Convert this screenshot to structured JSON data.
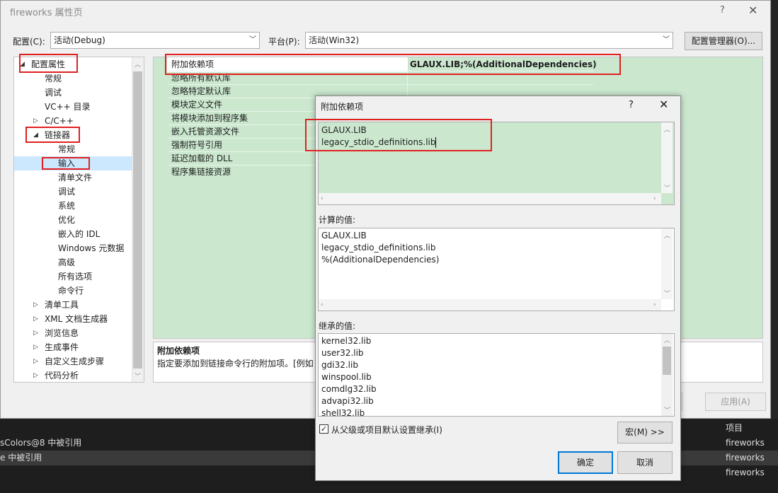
{
  "window": {
    "title": "fireworks 属性页",
    "help": "?",
    "close": "✕"
  },
  "toolbar": {
    "config_label": "配置(C):",
    "config_value": "活动(Debug)",
    "platform_label": "平台(P):",
    "platform_value": "活动(Win32)",
    "config_manager": "配置管理器(O)..."
  },
  "tree": {
    "items": [
      {
        "label": "配置属性",
        "expander": "◢"
      },
      {
        "label": "常规"
      },
      {
        "label": "调试"
      },
      {
        "label": "VC++ 目录"
      },
      {
        "label": "C/C++",
        "expander": "▷"
      },
      {
        "label": "链接器",
        "expander": "◢"
      },
      {
        "label": "常规"
      },
      {
        "label": "输入"
      },
      {
        "label": "清单文件"
      },
      {
        "label": "调试"
      },
      {
        "label": "系统"
      },
      {
        "label": "优化"
      },
      {
        "label": "嵌入的 IDL"
      },
      {
        "label": "Windows 元数据"
      },
      {
        "label": "高级"
      },
      {
        "label": "所有选项"
      },
      {
        "label": "命令行"
      },
      {
        "label": "清单工具",
        "expander": "▷"
      },
      {
        "label": "XML 文档生成器",
        "expander": "▷"
      },
      {
        "label": "浏览信息",
        "expander": "▷"
      },
      {
        "label": "生成事件",
        "expander": "▷"
      },
      {
        "label": "自定义生成步骤",
        "expander": "▷"
      },
      {
        "label": "代码分析",
        "expander": "▷"
      }
    ]
  },
  "grid": {
    "rows": [
      {
        "name": "附加依赖项",
        "value": "GLAUX.LIB;%(AdditionalDependencies)"
      },
      {
        "name": "忽略所有默认库"
      },
      {
        "name": "忽略特定默认库"
      },
      {
        "name": "模块定义文件"
      },
      {
        "name": "将模块添加到程序集"
      },
      {
        "name": "嵌入托管资源文件"
      },
      {
        "name": "强制符号引用"
      },
      {
        "name": "延迟加载的 DLL"
      },
      {
        "name": "程序集链接资源"
      }
    ],
    "description_title": "附加依赖项",
    "description_text": "指定要添加到链接命令行的附加项。[例如"
  },
  "bottom_buttons": {
    "apply": "应用(A)"
  },
  "dialog": {
    "title": "附加依赖项",
    "help": "?",
    "close": "✕",
    "edit_lines": [
      "GLAUX.LIB",
      "legacy_stdio_definitions.lib"
    ],
    "computed_label": "计算的值:",
    "computed_lines": [
      "GLAUX.LIB",
      "legacy_stdio_definitions.lib",
      "%(AdditionalDependencies)"
    ],
    "inherited_label": "继承的值:",
    "inherited_lines": [
      "kernel32.lib",
      "user32.lib",
      "gdi32.lib",
      "winspool.lib",
      "comdlg32.lib",
      "advapi32.lib",
      "shell32.lib"
    ],
    "inherit_checkbox": "从父级或项目默认设置继承(I)",
    "inherit_checked": true,
    "macro_button": "宏(M) >>",
    "ok_button": "确定",
    "cancel_button": "取消"
  },
  "background_panel": {
    "header": "项目",
    "rows": [
      {
        "left": "sColors@8 中被引用",
        "right": "fireworks"
      },
      {
        "left": "e 中被引用",
        "right": "fireworks"
      },
      {
        "left": "",
        "right": "fireworks"
      }
    ]
  },
  "colors": {
    "grid_green": "#cbe8cf",
    "highlight_red": "#e02020",
    "selection_blue": "#cce8ff"
  }
}
